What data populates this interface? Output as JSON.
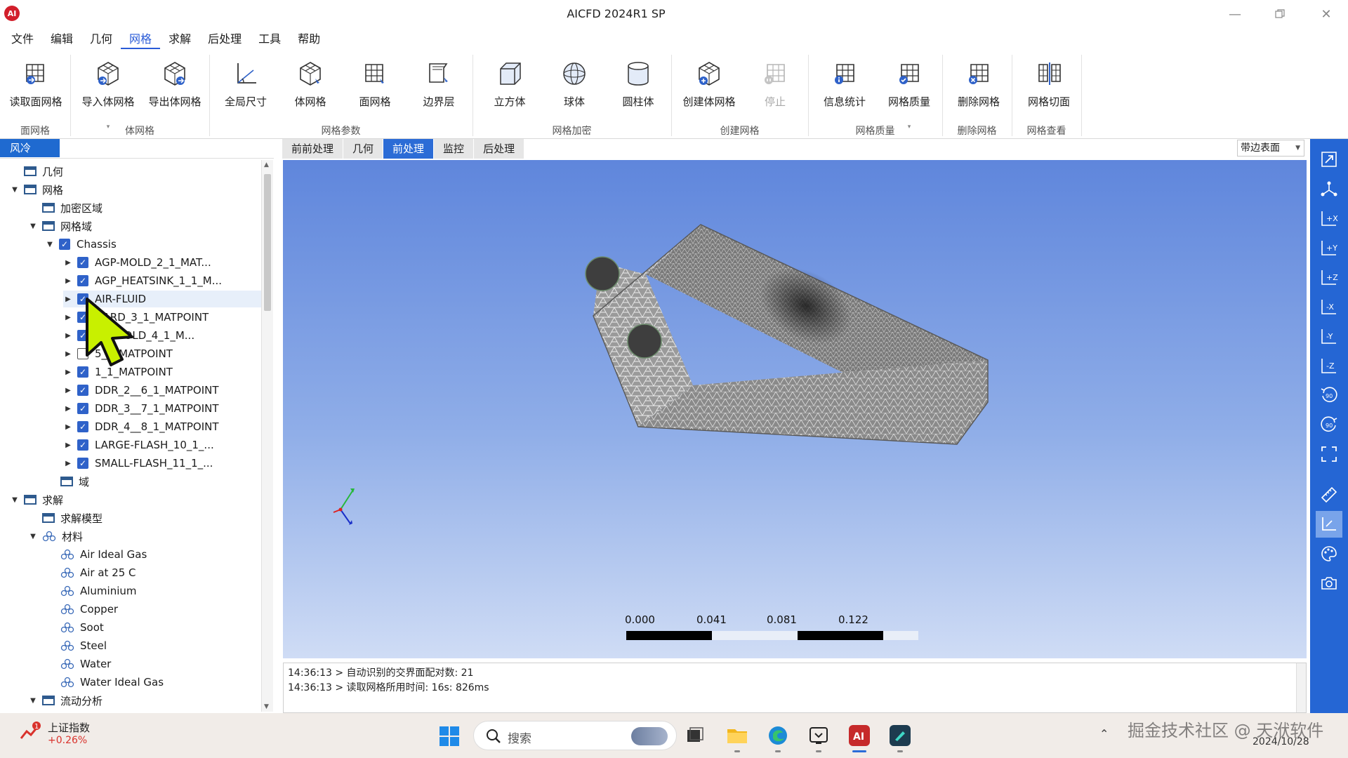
{
  "app": {
    "title": "AICFD 2024R1 SP",
    "logo_text": "AI"
  },
  "menu": [
    "文件",
    "编辑",
    "几何",
    "网格",
    "求解",
    "后处理",
    "工具",
    "帮助"
  ],
  "menu_active": "网格",
  "ribbon": {
    "buttons": [
      "读取面网格",
      "导入体网格",
      "导出体网格",
      "全局尺寸",
      "体网格",
      "面网格",
      "边界层",
      "立方体",
      "球体",
      "圆柱体",
      "创建体网格",
      "停止",
      "信息统计",
      "网格质量",
      "删除网格",
      "网格切面"
    ],
    "groups": [
      "面网格",
      "体网格",
      "网格参数",
      "网格加密",
      "创建网格",
      "网格质量",
      "删除网格",
      "网格查看"
    ]
  },
  "tree": {
    "tab_label": "风冷",
    "nodes": [
      {
        "label": "几何",
        "icon": "folder-icon"
      },
      {
        "label": "网格",
        "icon": "folder-icon"
      },
      {
        "label": "加密区域",
        "icon": "folder-icon"
      },
      {
        "label": "网格域",
        "icon": "folder-icon"
      },
      {
        "label": "Chassis",
        "icon": "checkbox-icon"
      },
      {
        "label": "AGP-MOLD_2_1_MAT...",
        "icon": "checkbox-icon"
      },
      {
        "label": "AGP_HEATSINK_1_1_M...",
        "icon": "checkbox-icon"
      },
      {
        "label": "AIR-FLUID",
        "icon": "checkbox-icon"
      },
      {
        "label": "OARD_3_1_MATPOINT",
        "icon": "checkbox-icon"
      },
      {
        "label": "GE_MOLD_4_1_M...",
        "icon": "checkbox-icon"
      },
      {
        "label": "5_1_MATPOINT",
        "icon": "checkbox-icon"
      },
      {
        "label": "1_1_MATPOINT",
        "icon": "checkbox-icon"
      },
      {
        "label": "DDR_2__6_1_MATPOINT",
        "icon": "checkbox-icon"
      },
      {
        "label": "DDR_3__7_1_MATPOINT",
        "icon": "checkbox-icon"
      },
      {
        "label": "DDR_4__8_1_MATPOINT",
        "icon": "checkbox-icon"
      },
      {
        "label": "LARGE-FLASH_10_1_...",
        "icon": "checkbox-icon"
      },
      {
        "label": "SMALL-FLASH_11_1_...",
        "icon": "checkbox-icon"
      },
      {
        "label": "域",
        "icon": "folder-icon"
      },
      {
        "label": "求解",
        "icon": "folder-icon"
      },
      {
        "label": "求解模型",
        "icon": "folder-icon"
      },
      {
        "label": "材料",
        "icon": "material-icon"
      },
      {
        "label": "Air Ideal Gas",
        "icon": "material-icon"
      },
      {
        "label": "Air at 25 C",
        "icon": "material-icon"
      },
      {
        "label": "Aluminium",
        "icon": "material-icon"
      },
      {
        "label": "Copper",
        "icon": "material-icon"
      },
      {
        "label": "Soot",
        "icon": "material-icon"
      },
      {
        "label": "Steel",
        "icon": "material-icon"
      },
      {
        "label": "Water",
        "icon": "material-icon"
      },
      {
        "label": "Water Ideal Gas",
        "icon": "material-icon"
      },
      {
        "label": "流动分析",
        "icon": "folder-icon"
      }
    ]
  },
  "center_tabs": [
    "前前处理",
    "几何",
    "前处理",
    "监控",
    "后处理"
  ],
  "center_tab_active": "前处理",
  "display_mode": "带边表面",
  "scale_bar": {
    "labels": [
      "0.000",
      "0.041",
      "0.081",
      "0.122"
    ]
  },
  "console": [
    "14:36:13 > 自动识别的交界面配对数: 21",
    "14:36:13 > 读取网格所用时间: 16s: 826ms"
  ],
  "right_toolbar": [
    "fit-view-icon",
    "axes-icon",
    "view-plus-x-icon",
    "view-plus-y-icon",
    "view-plus-z-icon",
    "view-minus-x-icon",
    "view-minus-y-icon",
    "view-minus-z-icon",
    "rotate-ccw-90-icon",
    "rotate-cw-90-icon",
    "fullscreen-icon",
    "ruler-icon",
    "axis-display-icon",
    "palette-icon",
    "camera-icon"
  ],
  "taskbar": {
    "stock_name": "上证指数",
    "stock_change": "+0.26%",
    "search_placeholder": "搜索",
    "watermark": "掘金技术社区 @ 天洑软件",
    "date": "2024/10/28"
  },
  "colors": {
    "accent": "#2c6cd6",
    "viewport_top": "#5f86dc",
    "viewport_bottom": "#cfdcf5",
    "stock_up": "#d9322c"
  }
}
